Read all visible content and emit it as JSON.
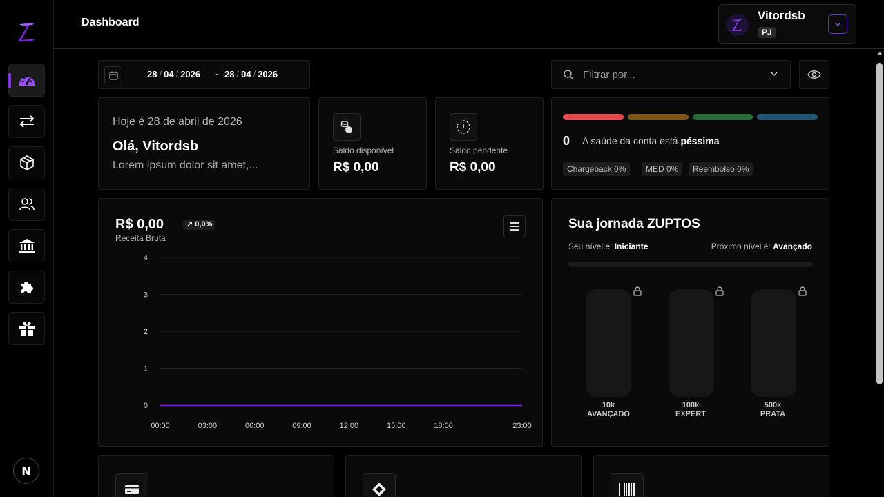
{
  "header": {
    "title": "Dashboard",
    "user": {
      "name": "Vitordsb",
      "type": "PJ"
    }
  },
  "date_range": {
    "start": {
      "day": "28",
      "month": "04",
      "year": "2026"
    },
    "end": {
      "day": "28",
      "month": "04",
      "year": "2026"
    },
    "separator": "/",
    "dash": "-"
  },
  "filter": {
    "placeholder": "Filtrar por..."
  },
  "welcome": {
    "date_line": "Hoje é 28 de abril de 2026",
    "greeting": "Olá, Vitordsb",
    "subtitle": "Lorem ipsum dolor sit amet,..."
  },
  "balances": [
    {
      "label": "Saldo disponível",
      "value": "R$ 0,00",
      "icon": "coins-icon"
    },
    {
      "label": "Saldo pendente",
      "value": "R$ 0,00",
      "icon": "pending-timer-icon"
    }
  ],
  "health": {
    "score": "0",
    "text_prefix": "A saúde da conta está",
    "status": "péssima",
    "bars": [
      "#e5484d",
      "#7a5417",
      "#2a6b3a",
      "#205470"
    ],
    "tags": [
      "Chargeback 0%",
      "MED 0%",
      "Reembolso 0%"
    ]
  },
  "revenue": {
    "value": "R$ 0,00",
    "change": "↗ 0,0%",
    "label": "Receita Bruta"
  },
  "chart_data": {
    "type": "line",
    "x": [
      "00:00",
      "03:00",
      "06:00",
      "09:00",
      "12:00",
      "15:00",
      "18:00",
      "23:00"
    ],
    "y_ticks": [
      "4",
      "3",
      "2",
      "1",
      "0"
    ],
    "ylim": [
      0,
      4
    ],
    "series": [
      {
        "values": [
          0,
          0,
          0,
          0,
          0,
          0,
          0,
          0
        ],
        "color": "#7b22e0"
      }
    ],
    "grid": true
  },
  "journey": {
    "title": "Sua jornada ZUPTOS",
    "current_prefix": "Seu nível é:",
    "current_level": "Iniciante",
    "next_prefix": "Próximo nível é:",
    "next_level": "Avançado",
    "progress": 0,
    "levels": [
      {
        "amount": "10k",
        "name": "AVANÇADO"
      },
      {
        "amount": "100k",
        "name": "EXPERT"
      },
      {
        "amount": "500k",
        "name": "PRATA"
      }
    ]
  },
  "sidebar": {
    "items": [
      "dashboard-icon",
      "transfers-icon",
      "products-icon",
      "users-icon",
      "bank-icon",
      "integrations-icon",
      "gift-icon"
    ],
    "footer_badge": "N"
  },
  "colors": {
    "accent": "#8b2cf5",
    "background": "#000000",
    "panel": "#0a0a0a"
  }
}
